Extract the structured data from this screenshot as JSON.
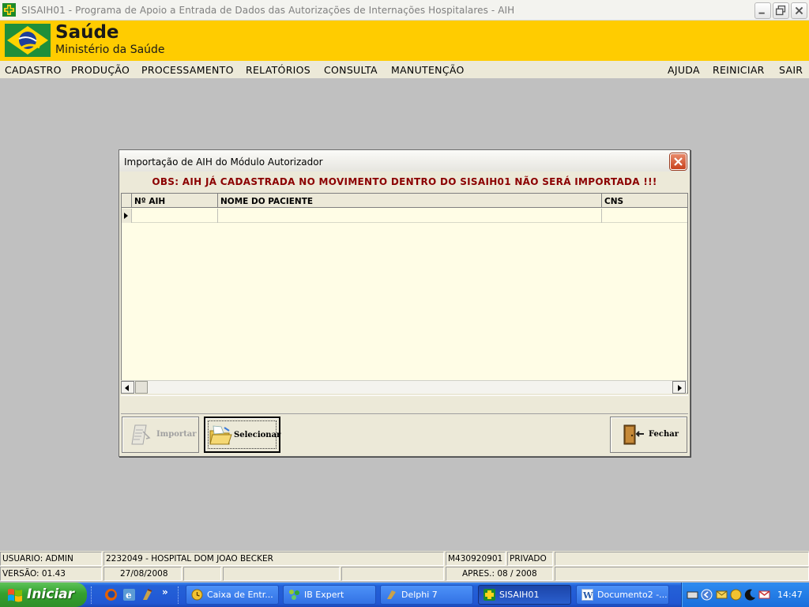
{
  "window": {
    "title": "SISAIH01 - Programa de Apoio a Entrada de Dados das Autorizações de Internações Hospitalares - AIH"
  },
  "banner": {
    "brand": "Saúde",
    "ministry": "Ministério da Saúde"
  },
  "menu": {
    "left": [
      "CADASTRO",
      "PRODUÇÃO",
      "PROCESSAMENTO",
      "RELATÓRIOS",
      "CONSULTA",
      "MANUTENÇÃO"
    ],
    "right": [
      "AJUDA",
      "REINICIAR",
      "SAIR"
    ]
  },
  "dialog": {
    "title": "Importação de AIH do Módulo Autorizador",
    "warning": "OBS: AIH JÁ CADASTRADA NO MOVIMENTO DENTRO DO SISAIH01 NÃO SERÁ IMPORTADA !!!",
    "columns": [
      "Nº AIH",
      "NOME DO PACIENTE",
      "CNS"
    ],
    "rows": [
      [
        "",
        "",
        ""
      ]
    ],
    "buttons": {
      "importar": "Importar",
      "selecionar": "Selecionar",
      "fechar": "Fechar"
    }
  },
  "statusbar": {
    "usuario": "USUARIO: ADMIN",
    "hospital": "2232049 - HOSPITAL DOM JOAO BECKER",
    "codigo": "M430920901",
    "tipo": "PRIVADO",
    "versao": "VERSÃO: 01.43",
    "data": "27/08/2008",
    "apres": "APRES.: 08 / 2008"
  },
  "taskbar": {
    "start": "Iniciar",
    "more": "»",
    "tasks": [
      "Caixa de Entr...",
      "IB Expert",
      "Delphi 7",
      "SISAIH01",
      "Documento2 -..."
    ],
    "clock": "14:47"
  },
  "colors": {
    "banner": "#ffcc00",
    "warning": "#8b0000",
    "grid_background": "#fffde6",
    "taskbar": "#2157d3"
  }
}
